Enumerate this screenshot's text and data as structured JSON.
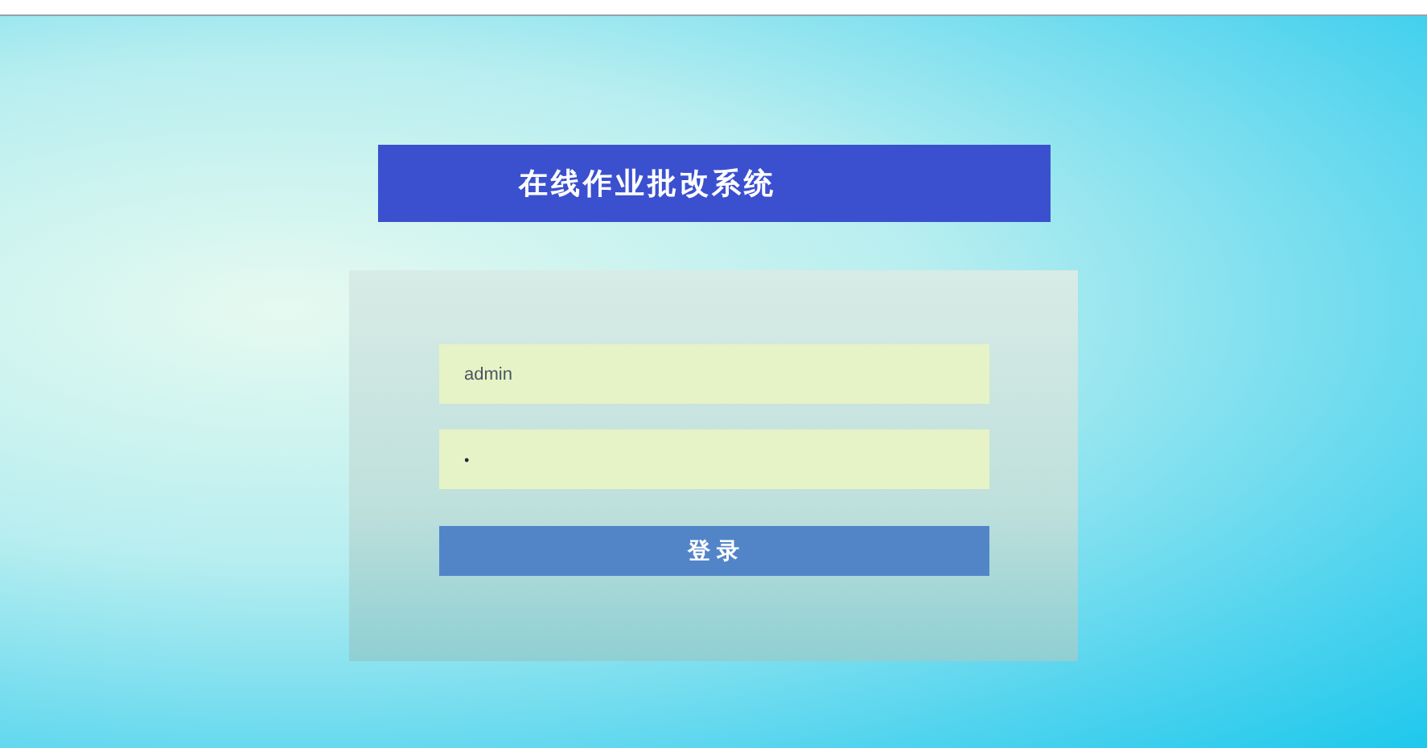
{
  "title": "在线作业批改系统",
  "username": {
    "value": "admin"
  },
  "password": {
    "value": "•"
  },
  "login_button": "登 录"
}
